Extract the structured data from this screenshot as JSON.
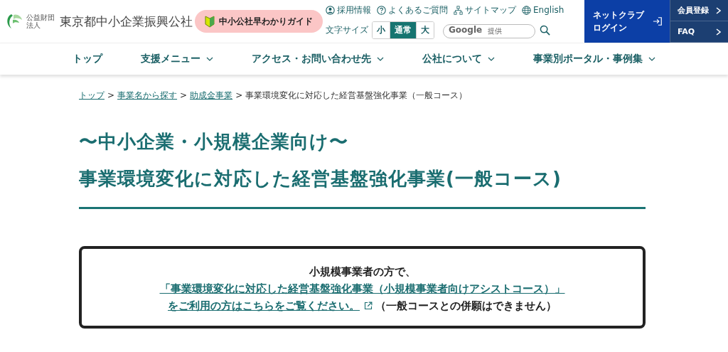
{
  "header": {
    "logo_small": "公益財団法人",
    "logo": "東京都中小企業振興公社",
    "guide_button": "中小公社早わかりガイド",
    "util_links": [
      {
        "kind": "person",
        "label": "採用情報"
      },
      {
        "kind": "question",
        "label": "よくあるご質問"
      },
      {
        "kind": "sitemap",
        "label": "サイトマップ"
      },
      {
        "kind": "globe",
        "label": "English"
      }
    ],
    "text_size_label": "文字サイズ",
    "text_sizes": [
      {
        "label": "小",
        "selected": false
      },
      {
        "label": "通常",
        "selected": true
      },
      {
        "label": "大",
        "selected": false
      }
    ],
    "search": {
      "brand": "Google",
      "placeholder": "提供"
    },
    "login_button": [
      "ネットクラブ",
      "ログイン"
    ],
    "side_buttons": [
      "会員登録",
      "FAQ"
    ]
  },
  "nav": [
    {
      "label": "トップ",
      "has_menu": false
    },
    {
      "label": "支援メニュー",
      "has_menu": true
    },
    {
      "label": "アクセス・お問い合わせ先",
      "has_menu": true
    },
    {
      "label": "公社について",
      "has_menu": true
    },
    {
      "label": "事業別ポータル・事例集",
      "has_menu": true
    }
  ],
  "breadcrumb": {
    "links": [
      "トップ",
      "事業名から探す",
      "助成金事業"
    ],
    "separator": ">",
    "current": "事業環境変化に対応した経営基盤強化事業（一般コース）"
  },
  "title_lines": [
    "〜中小企業・小規模企業向け〜",
    "事業環境変化に対応した経営基盤強化事業(一般コース)"
  ],
  "notice": {
    "lead": "小規模事業者の方で、",
    "link_lines": [
      "「事業環境変化に対応した経営基盤強化事業（小規模事業者向けアシストコース）」",
      "をご利用の方はこちらをご覧ください。"
    ],
    "note": "（一般コースとの併願はできません）"
  }
}
